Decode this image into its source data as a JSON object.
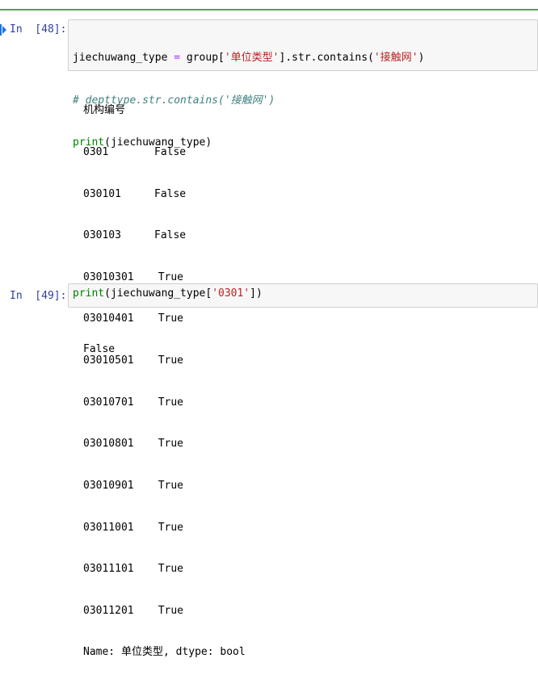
{
  "cells": [
    {
      "prompt": "In  [48]:",
      "code": {
        "line1": {
          "var": "jiechuwang_type",
          "op": " = ",
          "obj": "group[",
          "str1": "'单位类型'",
          "mid": "].str.contains(",
          "str2": "'接触网'",
          "end": ")"
        },
        "line2": "# depttype.str.contains('接触网')",
        "line3": {
          "fn": "print",
          "arg": "(jiechuwang_type)"
        }
      },
      "output": {
        "header": "机构编号",
        "rows": [
          {
            "key": "0301",
            "value": "False"
          },
          {
            "key": "030101",
            "value": "False"
          },
          {
            "key": "030103",
            "value": "False"
          },
          {
            "key": "03010301",
            "value": "True"
          },
          {
            "key": "03010401",
            "value": "True"
          },
          {
            "key": "03010501",
            "value": "True"
          },
          {
            "key": "03010701",
            "value": "True"
          },
          {
            "key": "03010801",
            "value": "True"
          },
          {
            "key": "03010901",
            "value": "True"
          },
          {
            "key": "03011001",
            "value": "True"
          },
          {
            "key": "03011101",
            "value": "True"
          },
          {
            "key": "03011201",
            "value": "True"
          }
        ],
        "footer": "Name: 单位类型, dtype: bool"
      }
    },
    {
      "prompt": "In  [49]:",
      "code": {
        "fn": "print",
        "pre": "(jiechuwang_type[",
        "str": "'0301'",
        "post": "])"
      },
      "output": {
        "text": "False"
      }
    }
  ],
  "colors": {
    "prompt": "#303f9f",
    "string": "#ba2121",
    "builtin": "#008000",
    "comment": "#408080",
    "operator": "#aa22ff",
    "selected_bar": "#1a73e8",
    "cell_border": "#52a152"
  }
}
